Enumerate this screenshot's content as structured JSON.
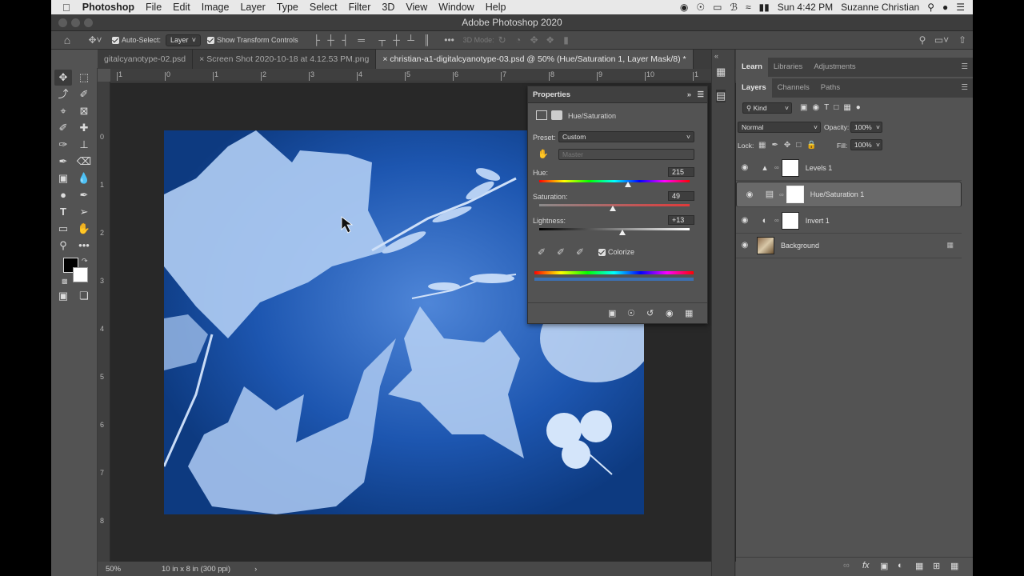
{
  "menubar": {
    "app": "Photoshop",
    "items": [
      "File",
      "Edit",
      "Image",
      "Layer",
      "Type",
      "Select",
      "Filter",
      "3D",
      "View",
      "Window",
      "Help"
    ],
    "clock": "Sun 4:42 PM",
    "user": "Suzanne Christian"
  },
  "window": {
    "title": "Adobe Photoshop 2020"
  },
  "options": {
    "auto_select_label": "Auto-Select:",
    "auto_select_value": "Layer",
    "transform_label": "Show Transform Controls",
    "mode_3d": "3D Mode:"
  },
  "tabs": [
    {
      "label": "gitalcyanotype-02.psd"
    },
    {
      "label": "Screen Shot 2020-10-18 at 4.12.53 PM.png"
    },
    {
      "label": "christian-a1-digitalcyanotype-03.psd @ 50% (Hue/Saturation 1, Layer Mask/8) *"
    }
  ],
  "ruler": {
    "top": [
      "1",
      "0",
      "1",
      "2",
      "3",
      "4",
      "5",
      "6",
      "7",
      "8",
      "9",
      "10",
      "1"
    ],
    "left": [
      "0",
      "1",
      "2",
      "3",
      "4",
      "5",
      "6",
      "7",
      "8"
    ]
  },
  "status": {
    "zoom": "50%",
    "doc": "10 in x 8 in (300 ppi)",
    "arrow": "›"
  },
  "properties": {
    "title": "Properties",
    "adjustment": "Hue/Saturation",
    "preset_label": "Preset:",
    "preset_value": "Custom",
    "channel": "Master",
    "hue_label": "Hue:",
    "hue": "215",
    "saturation_label": "Saturation:",
    "saturation": "49",
    "lightness_label": "Lightness:",
    "lightness": "+13",
    "colorize_label": "Colorize"
  },
  "panels": {
    "top_tabs": [
      "Learn",
      "Libraries",
      "Adjustments"
    ],
    "layer_tabs": [
      "Layers",
      "Channels",
      "Paths"
    ],
    "kind": "Kind",
    "blend": "Normal",
    "opacity_label": "Opacity:",
    "opacity": "100%",
    "lock_label": "Lock:",
    "fill_label": "Fill:",
    "fill": "100%",
    "layers": [
      {
        "name": "Levels 1"
      },
      {
        "name": "Hue/Saturation 1"
      },
      {
        "name": "Invert 1"
      },
      {
        "name": "Background"
      }
    ]
  },
  "colors": {
    "canvas_blue": "#1b4f9e",
    "panel": "#535353",
    "dark": "#282828"
  }
}
